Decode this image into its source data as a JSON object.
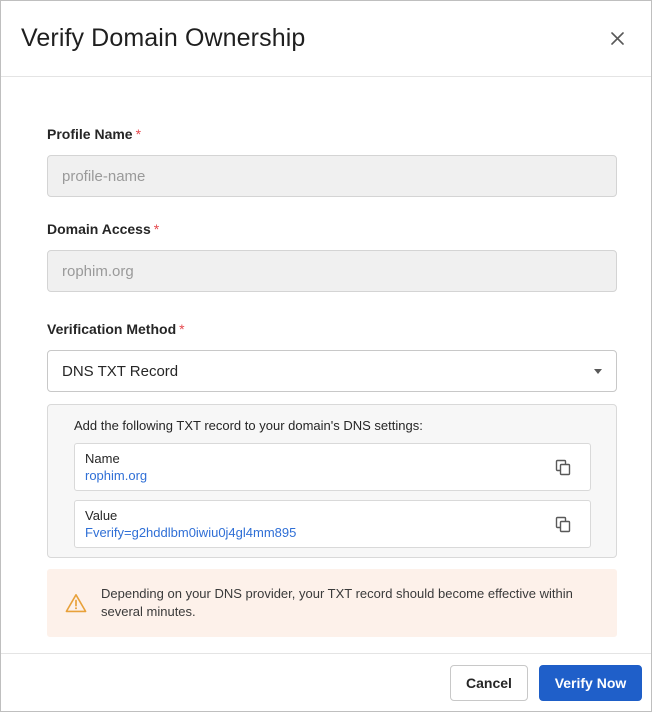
{
  "dialog": {
    "title": "Verify Domain Ownership"
  },
  "form": {
    "profile_name": {
      "label": "Profile Name",
      "required_mark": "*",
      "placeholder": "profile-name"
    },
    "domain_access": {
      "label": "Domain Access",
      "required_mark": "*",
      "value": "rophim.org"
    },
    "verification_method": {
      "label": "Verification Method",
      "required_mark": "*",
      "selected": "DNS TXT Record"
    }
  },
  "record": {
    "intro": "Add the following TXT record to your domain's DNS settings:",
    "rows": [
      {
        "key": "Name",
        "value": "rophim.org"
      },
      {
        "key": "Value",
        "value": "Fverify=g2hddlbm0iwiu0j4gl4mm895"
      }
    ]
  },
  "notice": {
    "text": "Depending on your DNS provider, your TXT record should become effective within several minutes."
  },
  "footer": {
    "cancel_label": "Cancel",
    "verify_label": "Verify Now"
  },
  "colors": {
    "primary": "#1f5fc9",
    "link": "#2f6fd6",
    "required": "#e5484d",
    "warning": "#e8a13a",
    "notice_bg": "#fdf1ea"
  },
  "icons": [
    "close-icon",
    "chevron-down-icon",
    "copy-icon",
    "warning-icon"
  ]
}
